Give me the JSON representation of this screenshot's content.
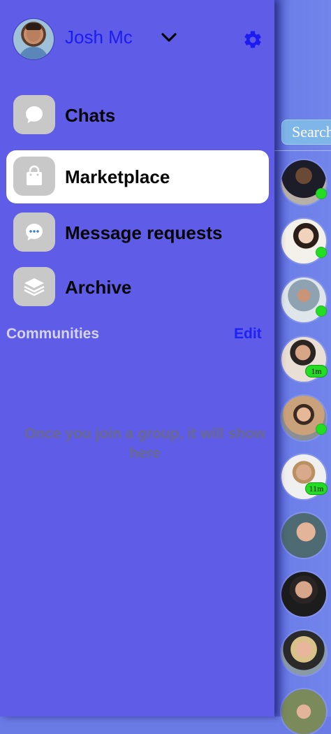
{
  "profile": {
    "name": "Josh Mc"
  },
  "menu": [
    {
      "label": "Chats",
      "icon": "chat-bubble-icon",
      "active": false
    },
    {
      "label": "Marketplace",
      "icon": "shopping-bag-icon",
      "active": true
    },
    {
      "label": "Message requests",
      "icon": "message-dots-icon",
      "active": false
    },
    {
      "label": "Archive",
      "icon": "archive-layers-icon",
      "active": false
    }
  ],
  "communities": {
    "label": "Communities",
    "edit_label": "Edit",
    "empty_message": "Once you join a group, it will show here"
  },
  "background_list": {
    "search_placeholder": "Search",
    "contacts": [
      {
        "status": "online",
        "time": ""
      },
      {
        "status": "online",
        "time": ""
      },
      {
        "status": "online",
        "time": ""
      },
      {
        "status": "away",
        "time": "1m"
      },
      {
        "status": "online",
        "time": ""
      },
      {
        "status": "away",
        "time": "11m"
      },
      {
        "status": "none",
        "time": ""
      },
      {
        "status": "none",
        "time": ""
      },
      {
        "status": "none",
        "time": ""
      },
      {
        "status": "none",
        "time": ""
      }
    ]
  },
  "colors": {
    "drawer_background": "#5f5ce8",
    "accent_blue": "#1d1cf0",
    "online_green": "#22dd22",
    "active_item": "#ffffff"
  }
}
